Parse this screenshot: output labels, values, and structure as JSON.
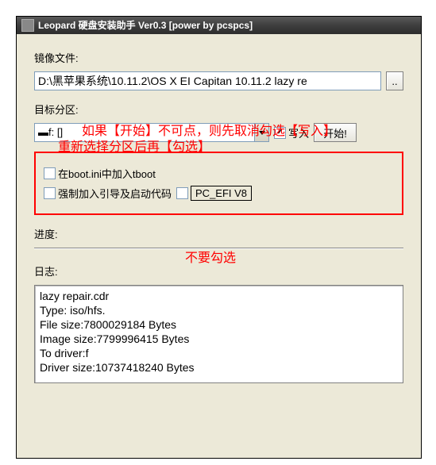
{
  "window": {
    "title": "Leopard 硬盘安装助手 Ver0.3 [power by pcspcs]"
  },
  "labels": {
    "image_file": "镜像文件:",
    "target_partition": "目标分区:",
    "progress": "进度:",
    "log": "日志:"
  },
  "file": {
    "path": "D:\\黑苹果系统\\10.11.2\\OS X EI Capitan 10.11.2 lazy re",
    "browse": ".."
  },
  "target": {
    "combo_value": "▬f: []",
    "write_label": "写入",
    "write_checked": true,
    "start_label": "开始!"
  },
  "options": {
    "tboot_label": "在boot.ini中加入tboot",
    "tboot_checked": false,
    "force_label": "强制加入引导及启动代码",
    "force_checked": false,
    "pcefi_label": "PC_EFI V8",
    "pcefi_checked": false
  },
  "log": {
    "text": "lazy repair.cdr\nType: iso/hfs.\nFile size:7800029184 Bytes\nImage size:7799996415 Bytes\nTo driver:f\nDriver size:10737418240 Bytes"
  },
  "annotations": {
    "line1": "如果【开始】不可点，则先取消勾选【写入】",
    "line2": "重新选择分区后再【勾选】",
    "no_check": "不要勾选"
  }
}
